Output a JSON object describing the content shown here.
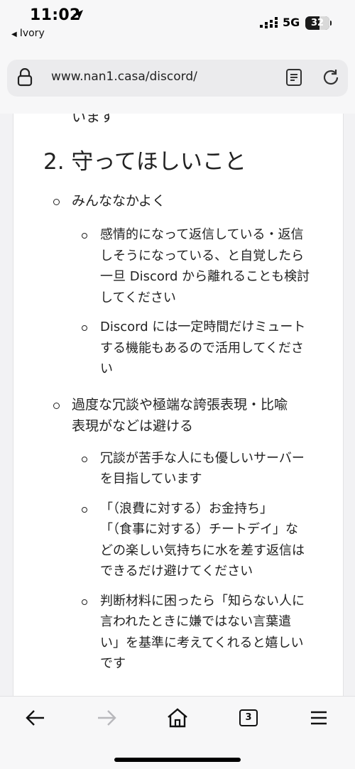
{
  "status": {
    "time": "11:02",
    "back_app": "Ivory",
    "network": "5G",
    "battery": "32"
  },
  "url_bar": {
    "url": "www.nan1.casa/discord/"
  },
  "content": {
    "cut_text": "います",
    "section_heading": "2. 守ってほしいこと",
    "rules": [
      {
        "text": "みんななかよく",
        "subs": [
          [
            "感情的になって返信している・返信",
            "しそうになっている、と自覚したら",
            "一旦 Discord から離れることも検討",
            "してください"
          ],
          [
            "Discord には一定時間だけミュート",
            "する機能もあるので活用してくださ",
            "い"
          ]
        ]
      },
      {
        "text": [
          "過度な冗談や極端な誇張表現・比喩",
          "表現がなどは避ける"
        ],
        "subs": [
          [
            "冗談が苦手な人にも優しいサーバー",
            "を目指しています"
          ],
          [
            "「（浪費に対する）お金持ち」",
            "「（食事に対する）チートデイ」な",
            "どの楽しい気持ちに水を差す返信は",
            "できるだけ避けてください"
          ],
          [
            "判断材料に困ったら「知らない人に",
            "言われたときに嫌ではない言葉遣",
            "い」を基準に考えてくれると嬉しい",
            "です"
          ]
        ]
      }
    ]
  },
  "toolbar": {
    "tab_count": "3"
  },
  "icons": {
    "back": "back-arrow-icon",
    "forward": "forward-arrow-icon",
    "home": "home-icon",
    "tabs": "tabs-icon",
    "menu": "menu-icon",
    "lock": "lock-icon",
    "reader": "reader-icon",
    "reload": "reload-icon"
  }
}
